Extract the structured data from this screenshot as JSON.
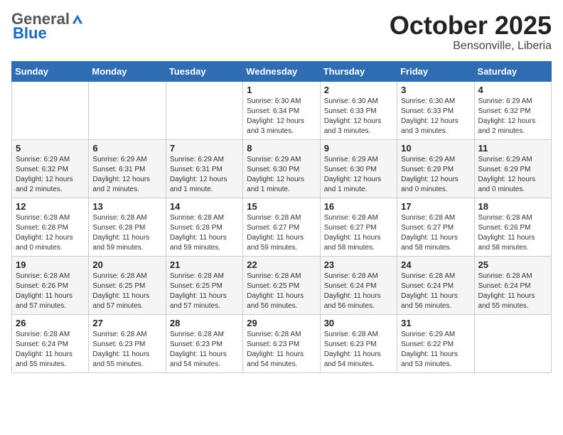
{
  "header": {
    "logo_general": "General",
    "logo_blue": "Blue",
    "month_title": "October 2025",
    "location": "Bensonville, Liberia"
  },
  "days_of_week": [
    "Sunday",
    "Monday",
    "Tuesday",
    "Wednesday",
    "Thursday",
    "Friday",
    "Saturday"
  ],
  "weeks": [
    [
      null,
      null,
      null,
      {
        "day": "1",
        "sunrise": "6:30 AM",
        "sunset": "6:34 PM",
        "daylight": "12 hours and 3 minutes."
      },
      {
        "day": "2",
        "sunrise": "6:30 AM",
        "sunset": "6:33 PM",
        "daylight": "12 hours and 3 minutes."
      },
      {
        "day": "3",
        "sunrise": "6:30 AM",
        "sunset": "6:33 PM",
        "daylight": "12 hours and 3 minutes."
      },
      {
        "day": "4",
        "sunrise": "6:29 AM",
        "sunset": "6:32 PM",
        "daylight": "12 hours and 2 minutes."
      }
    ],
    [
      {
        "day": "5",
        "sunrise": "6:29 AM",
        "sunset": "6:32 PM",
        "daylight": "12 hours and 2 minutes."
      },
      {
        "day": "6",
        "sunrise": "6:29 AM",
        "sunset": "6:31 PM",
        "daylight": "12 hours and 2 minutes."
      },
      {
        "day": "7",
        "sunrise": "6:29 AM",
        "sunset": "6:31 PM",
        "daylight": "12 hours and 1 minute."
      },
      {
        "day": "8",
        "sunrise": "6:29 AM",
        "sunset": "6:30 PM",
        "daylight": "12 hours and 1 minute."
      },
      {
        "day": "9",
        "sunrise": "6:29 AM",
        "sunset": "6:30 PM",
        "daylight": "12 hours and 1 minute."
      },
      {
        "day": "10",
        "sunrise": "6:29 AM",
        "sunset": "6:29 PM",
        "daylight": "12 hours and 0 minutes."
      },
      {
        "day": "11",
        "sunrise": "6:29 AM",
        "sunset": "6:29 PM",
        "daylight": "12 hours and 0 minutes."
      }
    ],
    [
      {
        "day": "12",
        "sunrise": "6:28 AM",
        "sunset": "6:28 PM",
        "daylight": "12 hours and 0 minutes."
      },
      {
        "day": "13",
        "sunrise": "6:28 AM",
        "sunset": "6:28 PM",
        "daylight": "11 hours and 59 minutes."
      },
      {
        "day": "14",
        "sunrise": "6:28 AM",
        "sunset": "6:28 PM",
        "daylight": "11 hours and 59 minutes."
      },
      {
        "day": "15",
        "sunrise": "6:28 AM",
        "sunset": "6:27 PM",
        "daylight": "11 hours and 59 minutes."
      },
      {
        "day": "16",
        "sunrise": "6:28 AM",
        "sunset": "6:27 PM",
        "daylight": "11 hours and 58 minutes."
      },
      {
        "day": "17",
        "sunrise": "6:28 AM",
        "sunset": "6:27 PM",
        "daylight": "11 hours and 58 minutes."
      },
      {
        "day": "18",
        "sunrise": "6:28 AM",
        "sunset": "6:26 PM",
        "daylight": "11 hours and 58 minutes."
      }
    ],
    [
      {
        "day": "19",
        "sunrise": "6:28 AM",
        "sunset": "6:26 PM",
        "daylight": "11 hours and 57 minutes."
      },
      {
        "day": "20",
        "sunrise": "6:28 AM",
        "sunset": "6:25 PM",
        "daylight": "11 hours and 57 minutes."
      },
      {
        "day": "21",
        "sunrise": "6:28 AM",
        "sunset": "6:25 PM",
        "daylight": "11 hours and 57 minutes."
      },
      {
        "day": "22",
        "sunrise": "6:28 AM",
        "sunset": "6:25 PM",
        "daylight": "11 hours and 56 minutes."
      },
      {
        "day": "23",
        "sunrise": "6:28 AM",
        "sunset": "6:24 PM",
        "daylight": "11 hours and 56 minutes."
      },
      {
        "day": "24",
        "sunrise": "6:28 AM",
        "sunset": "6:24 PM",
        "daylight": "11 hours and 56 minutes."
      },
      {
        "day": "25",
        "sunrise": "6:28 AM",
        "sunset": "6:24 PM",
        "daylight": "11 hours and 55 minutes."
      }
    ],
    [
      {
        "day": "26",
        "sunrise": "6:28 AM",
        "sunset": "6:24 PM",
        "daylight": "11 hours and 55 minutes."
      },
      {
        "day": "27",
        "sunrise": "6:28 AM",
        "sunset": "6:23 PM",
        "daylight": "11 hours and 55 minutes."
      },
      {
        "day": "28",
        "sunrise": "6:28 AM",
        "sunset": "6:23 PM",
        "daylight": "11 hours and 54 minutes."
      },
      {
        "day": "29",
        "sunrise": "6:28 AM",
        "sunset": "6:23 PM",
        "daylight": "11 hours and 54 minutes."
      },
      {
        "day": "30",
        "sunrise": "6:28 AM",
        "sunset": "6:23 PM",
        "daylight": "11 hours and 54 minutes."
      },
      {
        "day": "31",
        "sunrise": "6:29 AM",
        "sunset": "6:22 PM",
        "daylight": "11 hours and 53 minutes."
      },
      null
    ]
  ]
}
